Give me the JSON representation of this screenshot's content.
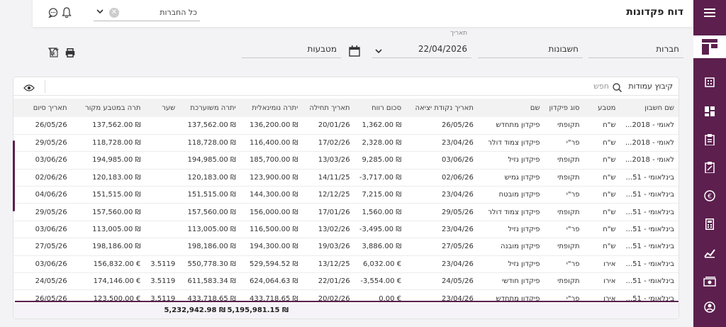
{
  "header": {
    "title": "דוח פקדונות",
    "company_filter": "כל החברות"
  },
  "filters": {
    "companies": "חברות",
    "accounts": "חשבונות",
    "date_label": "תאריך",
    "date": "22/04/2026",
    "currencies": "מטבעות"
  },
  "table": {
    "group_columns": "קיבוץ עמודות",
    "search_placeholder": "חפש",
    "columns": [
      "שם חשבון",
      "מטבע",
      "סוג פיקדון",
      "שם",
      "תאריך נקודת יציאה",
      "סכום רווח",
      "תאריך תחילה",
      "יתרה נומינאלית",
      "יתרה משוערכת",
      "שער",
      "תרה במטבע מקור",
      "תאריך סיום"
    ],
    "rows": [
      [
        "לאומי - 2018...",
        "ש\"ח",
        "תקופתי",
        "פיקדון מתחדש",
        "26/05/26",
        "1,362.00 ₪",
        "20/01/26",
        "136,200.00 ₪",
        "137,562.00 ₪",
        "",
        "137,562.00 ₪",
        "26/05/26"
      ],
      [
        "לאומי - 2018...",
        "ש\"ח",
        "פר\"י",
        "פיקדון צמוד דולר",
        "23/04/26",
        "2,328.00 ₪",
        "17/02/26",
        "116,400.00 ₪",
        "118,728.00 ₪",
        "",
        "118,728.00 ₪",
        "29/05/26"
      ],
      [
        "לאומי - 2018...",
        "ש\"ח",
        "תקופתי",
        "פיקדון נזיל",
        "03/06/26",
        "9,285.00 ₪",
        "13/03/26",
        "185,700.00 ₪",
        "194,985.00 ₪",
        "",
        "194,985.00 ₪",
        "03/06/26"
      ],
      [
        "בינלאומי - 51...",
        "ש\"ח",
        "תקופתי",
        "פיקדון גמיש",
        "02/06/26",
        "-3,717.00 ₪",
        "14/11/25",
        "123,900.00 ₪",
        "120,183.00 ₪",
        "",
        "120,183.00 ₪",
        "02/06/26"
      ],
      [
        "בינלאומי - 51...",
        "ש\"ח",
        "פר\"י",
        "פיקדון מובטח",
        "23/04/26",
        "7,215.00 ₪",
        "12/12/25",
        "144,300.00 ₪",
        "151,515.00 ₪",
        "",
        "151,515.00 ₪",
        "04/06/26"
      ],
      [
        "בינלאומי - 51...",
        "ש\"ח",
        "תקופתי",
        "פיקדון צמוד דולר",
        "29/05/26",
        "1,560.00 ₪",
        "17/01/26",
        "156,000.00 ₪",
        "157,560.00 ₪",
        "",
        "157,560.00 ₪",
        "29/05/26"
      ],
      [
        "בינלאומי - 51...",
        "ש\"ח",
        "פר\"י",
        "פיקדון נזיל",
        "23/04/26",
        "-3,495.00 ₪",
        "13/02/26",
        "116,500.00 ₪",
        "113,005.00 ₪",
        "",
        "113,005.00 ₪",
        "03/06/26"
      ],
      [
        "בינלאומי - 51...",
        "ש\"ח",
        "תקופתי",
        "פיקדון מובנה",
        "27/05/26",
        "3,886.00 ₪",
        "19/03/26",
        "194,300.00 ₪",
        "198,186.00 ₪",
        "",
        "198,186.00 ₪",
        "27/05/26"
      ],
      [
        "בינלאומי - 51...",
        "אירו",
        "פר\"י",
        "פיקדון נזיל",
        "23/04/26",
        "6,032.00 €",
        "13/12/25",
        "529,594.52 ₪",
        "550,778.30 ₪",
        "3.5119",
        "156,832.00 €",
        "03/06/26"
      ],
      [
        "בינלאומי - 51...",
        "אירו",
        "תקופתי",
        "פיקדון חודשי",
        "24/05/26",
        "-3,554.00 €",
        "22/01/26",
        "624,064.63 ₪",
        "611,583.34 ₪",
        "3.5119",
        "174,146.00 €",
        "24/05/26"
      ],
      [
        "בינלאומי - 51...",
        "אירו",
        "פר\"י",
        "פיקדון מתחדש",
        "23/04/26",
        "0.00 €",
        "20/02/26",
        "433,718.65 ₪",
        "433,718.65 ₪",
        "3.5119",
        "123,500.00 €",
        "26/05/26"
      ]
    ],
    "totals": {
      "nominal": "5,195,981.15 ₪",
      "revalued": "5,232,942.98 ₪"
    }
  },
  "colors": {
    "brand": "#5c1f4e"
  }
}
